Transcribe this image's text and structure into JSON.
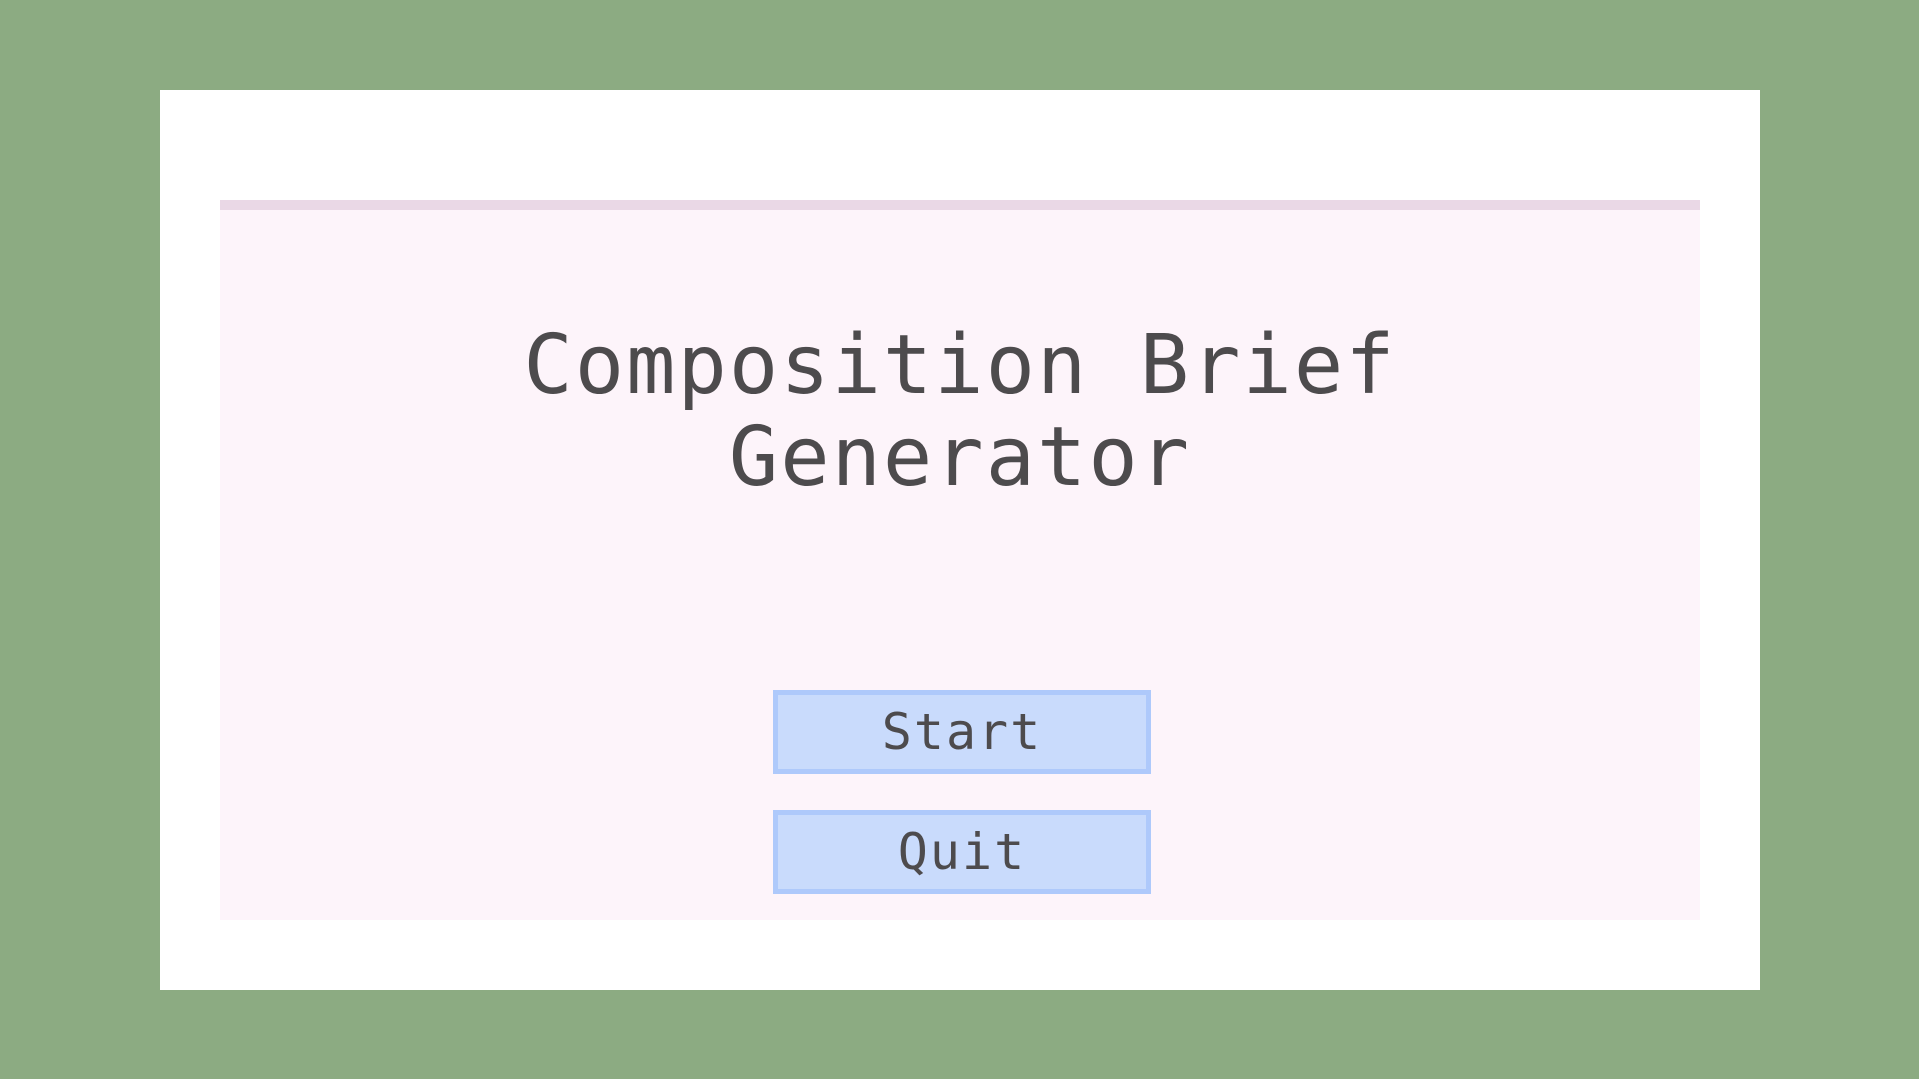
{
  "menu": {
    "title_line1": "Composition Brief",
    "title_line2": "Generator",
    "start_label": "Start",
    "quit_label": "Quit"
  },
  "colors": {
    "background": "#8cab82",
    "window": "#ffffff",
    "panel": "#fdf4fa",
    "panel_topbar": "#ead8e6",
    "button_fill": "#c9dbfc",
    "button_border": "#aec9fb",
    "text": "#4d4b4d"
  }
}
